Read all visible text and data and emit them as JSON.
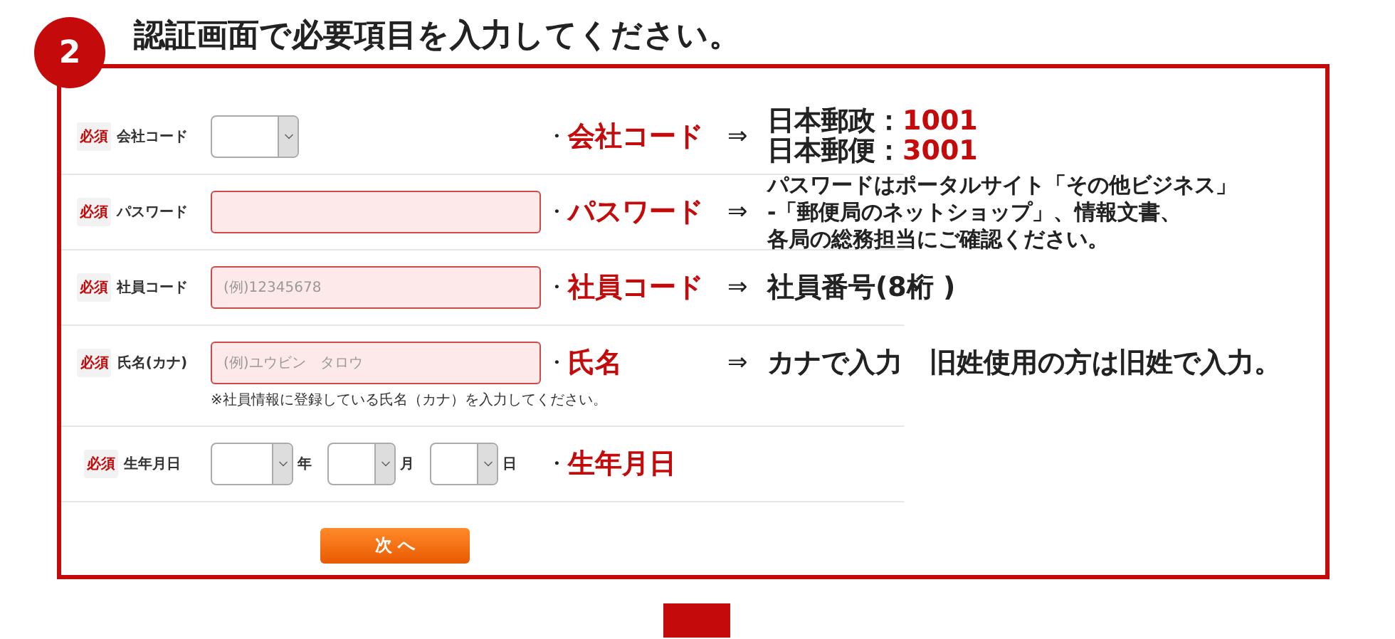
{
  "step": {
    "number": "2",
    "title": "認証画面で必要項目を入力してください。"
  },
  "rows": [
    {
      "kind": "select",
      "badge": "必須",
      "label": "会社コード",
      "annotation": {
        "bullet": "・",
        "label": "会社コード",
        "arrow": "⇒",
        "lines": [
          {
            "text": "日本郵政：",
            "value": "1001"
          },
          {
            "text": "日本郵便：",
            "value": "3001"
          }
        ]
      }
    },
    {
      "kind": "input",
      "badge": "必須",
      "label": "パスワード",
      "annotation": {
        "bullet": "・",
        "label": "パスワード",
        "arrow": "⇒",
        "lines": [
          {
            "text": "パスワードはポータルサイト「その他ビジネス」"
          },
          {
            "text": "-「郵便局のネットショップ」、情報文書、"
          },
          {
            "text": "各局の総務担当にご確認ください。"
          }
        ]
      }
    },
    {
      "kind": "input",
      "badge": "必須",
      "label": "社員コード",
      "placeholder": "(例)12345678",
      "annotation": {
        "bullet": "・",
        "label": "社員コード",
        "arrow": "⇒",
        "lines": [
          {
            "text": "社員番号(8桁 )"
          }
        ]
      }
    },
    {
      "kind": "input",
      "badge": "必須",
      "label": "氏名(カナ)",
      "placeholder": "(例)ユウビン　タロウ",
      "note": "※社員情報に登録している氏名（カナ）を入力してください。",
      "annotation": {
        "bullet": "・",
        "label": "氏名",
        "arrow": "⇒",
        "lines": [
          {
            "text": "カナで入力　旧姓使用の方は旧姓で入力。"
          }
        ]
      }
    },
    {
      "kind": "date",
      "badge": "必須",
      "label": "生年月日",
      "selects": [
        {
          "unit": "年"
        },
        {
          "unit": "月"
        },
        {
          "unit": "日"
        }
      ],
      "annotation": {
        "bullet": "・",
        "label": "生年月日"
      }
    }
  ],
  "button": "次 へ"
}
